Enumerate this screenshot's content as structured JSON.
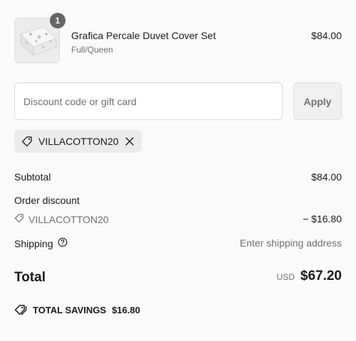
{
  "line_item": {
    "quantity": "1",
    "title": "Grafica Percale Duvet Cover Set",
    "variant": "Full/Queen",
    "price": "$84.00"
  },
  "discount": {
    "placeholder": "Discount code or gift card",
    "value": "",
    "apply_label": "Apply",
    "applied_code": "VILLACOTTON20"
  },
  "summary": {
    "subtotal_label": "Subtotal",
    "subtotal_value": "$84.00",
    "order_discount_label": "Order discount",
    "discount_code": "VILLACOTTON20",
    "discount_amount": "− $16.80",
    "shipping_label": "Shipping",
    "shipping_value": "Enter shipping address",
    "total_label": "Total",
    "currency": "USD",
    "total_value": "$67.20",
    "savings_label": "TOTAL SAVINGS",
    "savings_value": "$16.80"
  },
  "colors": {
    "background": "#fafafa",
    "muted_text": "#707070",
    "badge": "#666666"
  },
  "icons": [
    "product-thumbnail",
    "tag-icon",
    "close-icon",
    "help-icon",
    "savings-tag-icon"
  ]
}
